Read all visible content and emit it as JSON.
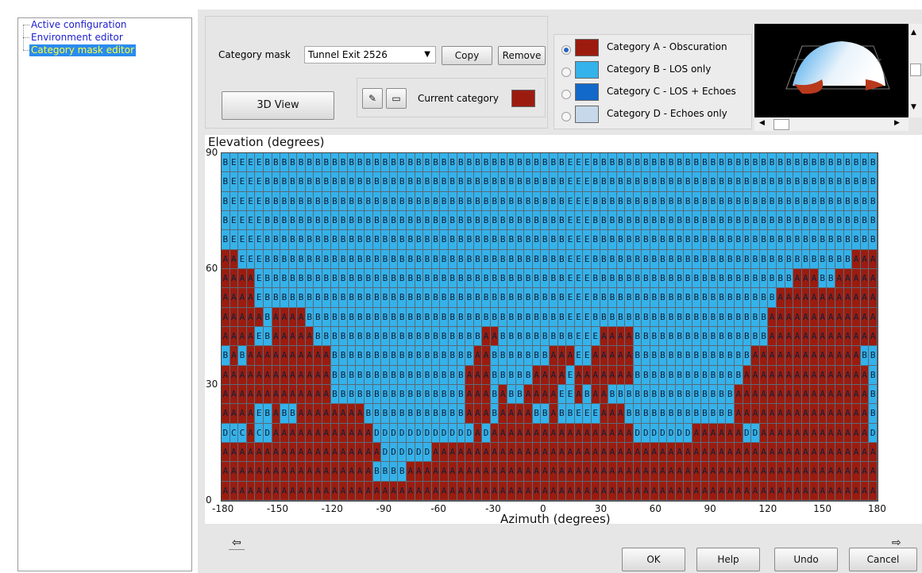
{
  "tree": {
    "items": [
      {
        "label": "Active configuration",
        "selected": false
      },
      {
        "label": "Environment editor",
        "selected": false
      },
      {
        "label": "Category mask editor",
        "selected": true
      }
    ]
  },
  "controls": {
    "category_mask_label": "Category mask",
    "category_mask_value": "Tunnel Exit 2526",
    "copy_label": "Copy",
    "remove_label": "Remove",
    "view3d_label": "3D View",
    "current_category_label": "Current category",
    "current_category_color": "#9b1c0f"
  },
  "categories": [
    {
      "label": "Category A - Obscuration",
      "color": "#9b1c0f",
      "selected": true
    },
    {
      "label": "Category B - LOS only",
      "color": "#34b2ea",
      "selected": false
    },
    {
      "label": "Category C - LOS + Echoes",
      "color": "#1369c9",
      "selected": false
    },
    {
      "label": "Category D - Echoes only",
      "color": "#c6d8ea",
      "selected": false
    }
  ],
  "mask_plot": {
    "ylabel": "Elevation (degrees)",
    "xlabel": "Azimuth (degrees)",
    "xticks": [
      "-180",
      "-150",
      "-120",
      "-90",
      "-60",
      "-30",
      "0",
      "30",
      "60",
      "90",
      "120",
      "150",
      "180"
    ],
    "yticks": [
      "90",
      "60",
      "30",
      "0"
    ],
    "colors": {
      "A": "#9b1c0f",
      "B": "#34b2ea",
      "C": "#34b2ea",
      "D": "#34b2ea",
      "E": "#34b2ea"
    },
    "rows": [
      "BEEEEBBBBBBBBBBBBBBBBBBBBBBBBBBBBBBBBBBBBEEEBBBBBBBBBBBBBBBBBBBBBBBBBBBBBBBBBB",
      "BEEEEBBBBBBBBBBBBBBBBBBBBBBBBBBBBBBBBBBBBEEEBBBBBBBBBBBBBBBBBBBBBBBBBBBBBBBBBB",
      "BEEEEBBBBBBBBBBBBBBBBBBBBBBBBBBBBBBBBBBBBEEEBBBBBBBBBBBBBBBBBBBBBBBBBBBBBBBBBB",
      "BEEEEBBBBBBBBBBBBBBBBBBBBBBBBBBBBBBBBBBBBEEEBBBBBBBBBBBBBBBBBBBBBBBBBBBBBBBBBB",
      "BEEEEBBBBBBBBBBBBBBBBBBBBBBBBBBBBBBBBBBBBEEEBBBBBBBBBBBBBBBBBBBBBBBBBBBBBBBBBB",
      "AAEEEBBBBBBBBBBBBBBBBBBBBBBBBBBBBBBBBBBBBEEEBBBBBBBBBBBBBBBBBBBBBBBBBBBBBBBAAA",
      "AAAAEBBBBBBBBBBBBBBBBBBBBBBBBBBBBBBBBBBBBEEEBBBBBBBBBBBBBBBBBBBBBBBBAAABBAAAAA",
      "AAAAEBBBBBBBBBBBBBBBBBBBBBBBBBBBBBBBBBBBBEEEBBBBBBBBBBBBBBBBBBBBBBAAAAAAAAAAAA",
      "AAAAABAAAABBBBBBBBBBBBBBBBBBBBBBBBBBBBBBBEEEBBBBBBBBBBBBBBBBBBBBBAAAAAAAAAAAAA",
      "AAAAEBAAAAABBBBBBBBBBBBBBBBBBBBAABBBBBBBBBEEEAAAABBBBBBBBBBBBBBBBAAAAAAAAAAAAA",
      "BABAAAAAAAAAABBBBBBBBBBBBBBBBBAABBBBBBBAAAEEAAAAABBBBBBBBBBBBBBAAAAAAAAAAAAAB",
      "AAAAAAAAAAAAABBBBBBBBBBBBBBBBAAABBBBBAAAAEAAAAAAABBBBBBBBBBBBBAAAAAAAAAAAAAAA",
      "AAAAAAAAAAAAABBBBBBBBBBBBBBBBAAABABBAAAAEEABAABBBBBBBBBBBBBBBAAAAAAAAAAAAAAAA",
      "AAAAEBABBAAAAAAAABBBBBBBBBBBBAAABAAAABBABBEEEAAABBBBBBBBBBBBBAAAAAAAAAAAAAAAA",
      "DCCACDAAAAAAAAAAAADDDDDDDDDDDDADAAAAAAAAAAAAAAAAADDDDDDDAAAAAADDAAAAAAAAAAAAAD",
      "AAAAAAAAAAAAAAAAAAADDDDDDAAAAAAAAAAAAAAAAAAAAAAAAAAAAAAAAAAAAAAAAAAAAAAAAAAAAA",
      "AAAAAAAAAAAAAAAAAABBBBAAAAAAAAAAAAAAAAAAAAAAAAAAAAAAAAAAAAAAAAAAAAAAAAAAAAAAAA",
      "AAAAAAAAAAAAAAAAAAAAAAAAAAAAAAAAAAAAAAAAAAAAAAAAAAAAAAAAAAAAAAAAAAAAAAAAAAAAAA"
    ]
  },
  "buttons": {
    "ok": "OK",
    "help": "Help",
    "undo": "Undo",
    "cancel": "Cancel",
    "back_arrow": "⇦",
    "forward_arrow": "⇨"
  }
}
